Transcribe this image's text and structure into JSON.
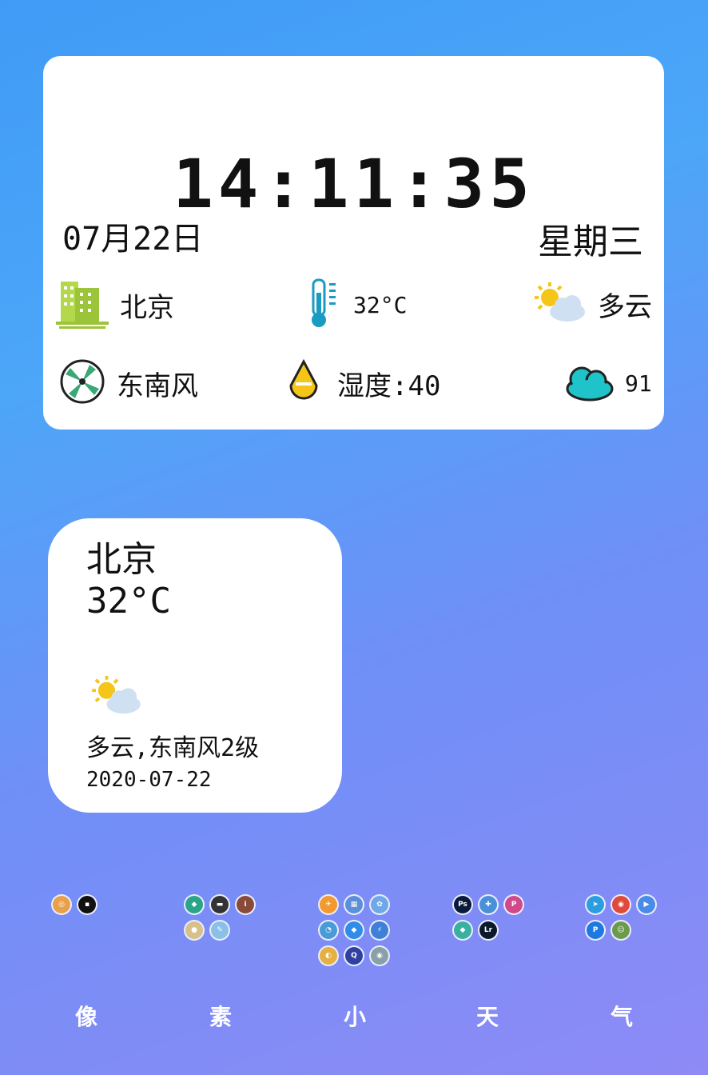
{
  "clock_widget": {
    "time": "14:11:35",
    "date": "07月22日",
    "weekday": "星期三",
    "city": "北京",
    "city_icon": "city-building-icon",
    "temperature": "32°C",
    "temperature_icon": "thermometer-icon",
    "condition": "多云",
    "condition_icon": "partly-cloudy-icon",
    "wind": "东南风",
    "wind_icon": "fan-icon",
    "humidity": "湿度:40",
    "humidity_icon": "water-drop-icon",
    "aqi": "91",
    "aqi_icon": "cloud-icon"
  },
  "weather_widget": {
    "city": "北京",
    "temperature": "32°C",
    "weather_icon": "partly-cloudy-icon",
    "condition_line": "多云,东南风2级",
    "date": "2020-07-22"
  },
  "dock": {
    "folders": [
      {
        "label": "像"
      },
      {
        "label": "素"
      },
      {
        "label": "小"
      },
      {
        "label": "天"
      },
      {
        "label": "气"
      }
    ]
  },
  "colors": {
    "background_top": "#3f9bf6",
    "background_bottom": "#8e8af6",
    "card": "#ffffff",
    "text": "#111111"
  }
}
